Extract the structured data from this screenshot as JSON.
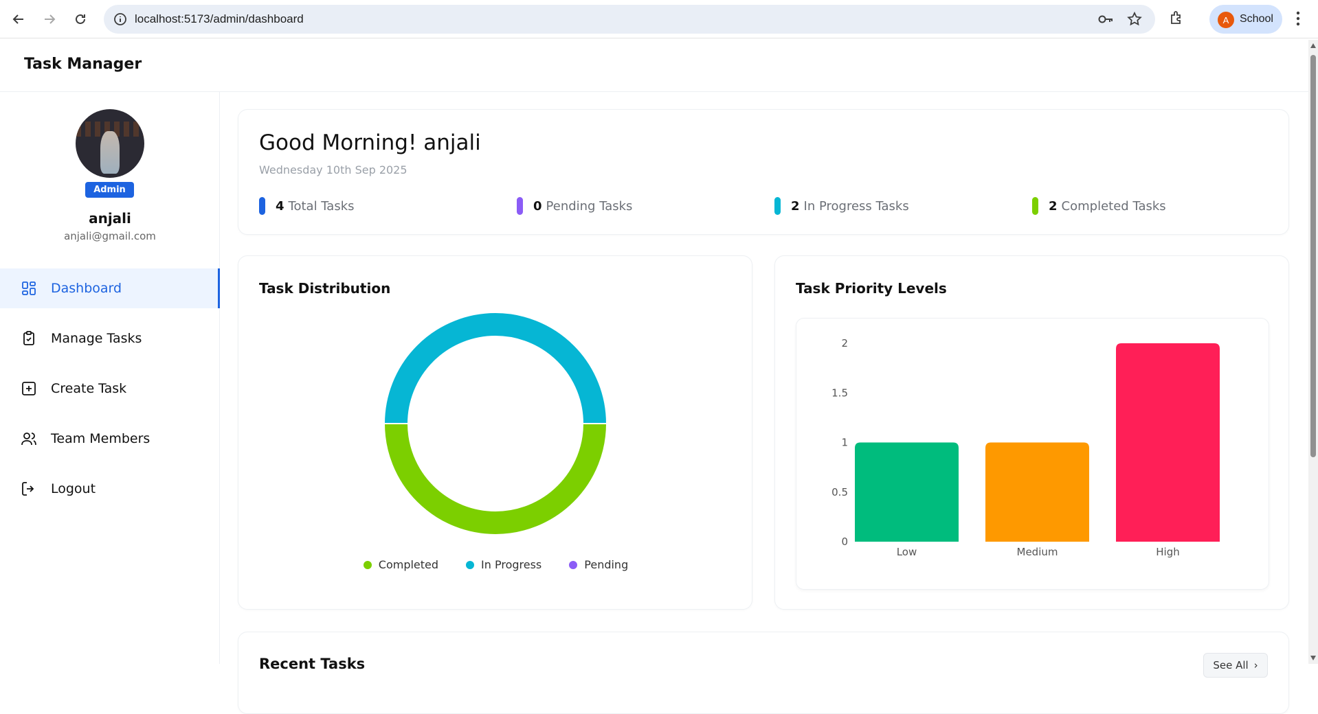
{
  "browser": {
    "url": "localhost:5173/admin/dashboard",
    "profile_initial": "A",
    "profile_label": "School"
  },
  "app": {
    "title": "Task Manager"
  },
  "sidebar": {
    "role": "Admin",
    "user_name": "anjali",
    "user_email": "anjali@gmail.com",
    "items": [
      {
        "label": "Dashboard",
        "icon": "dashboard-icon"
      },
      {
        "label": "Manage Tasks",
        "icon": "clipboard-check-icon"
      },
      {
        "label": "Create Task",
        "icon": "square-plus-icon"
      },
      {
        "label": "Team Members",
        "icon": "users-icon"
      },
      {
        "label": "Logout",
        "icon": "logout-icon"
      }
    ]
  },
  "greeting": {
    "title": "Good Morning! anjali",
    "date": "Wednesday 10th Sep 2025",
    "stats": [
      {
        "value": "4",
        "label": "Total Tasks",
        "color": "#1d63e0"
      },
      {
        "value": "0",
        "label": "Pending Tasks",
        "color": "#8b5cf6"
      },
      {
        "value": "2",
        "label": "In Progress Tasks",
        "color": "#06b6d4"
      },
      {
        "value": "2",
        "label": "Completed Tasks",
        "color": "#7ccf00"
      }
    ]
  },
  "distribution": {
    "title": "Task Distribution",
    "legend": [
      "Completed",
      "In Progress",
      "Pending"
    ]
  },
  "priority": {
    "title": "Task Priority Levels"
  },
  "recent": {
    "title": "Recent Tasks",
    "see_all": "See All"
  },
  "chart_data": [
    {
      "type": "pie",
      "categories": [
        "Completed",
        "In Progress",
        "Pending"
      ],
      "values": [
        2,
        2,
        0
      ],
      "colors": [
        "#7ccf00",
        "#06b6d4",
        "#8b5cf6"
      ],
      "legend": "bottom",
      "donut": true
    },
    {
      "type": "bar",
      "categories": [
        "Low",
        "Medium",
        "High"
      ],
      "values": [
        1,
        1,
        2
      ],
      "colors": [
        "#00bc7d",
        "#fe9900",
        "#ff1f57"
      ],
      "ylim": [
        0,
        2
      ],
      "yticks": [
        "0",
        "0.5",
        "1",
        "1.5",
        "2"
      ]
    }
  ]
}
